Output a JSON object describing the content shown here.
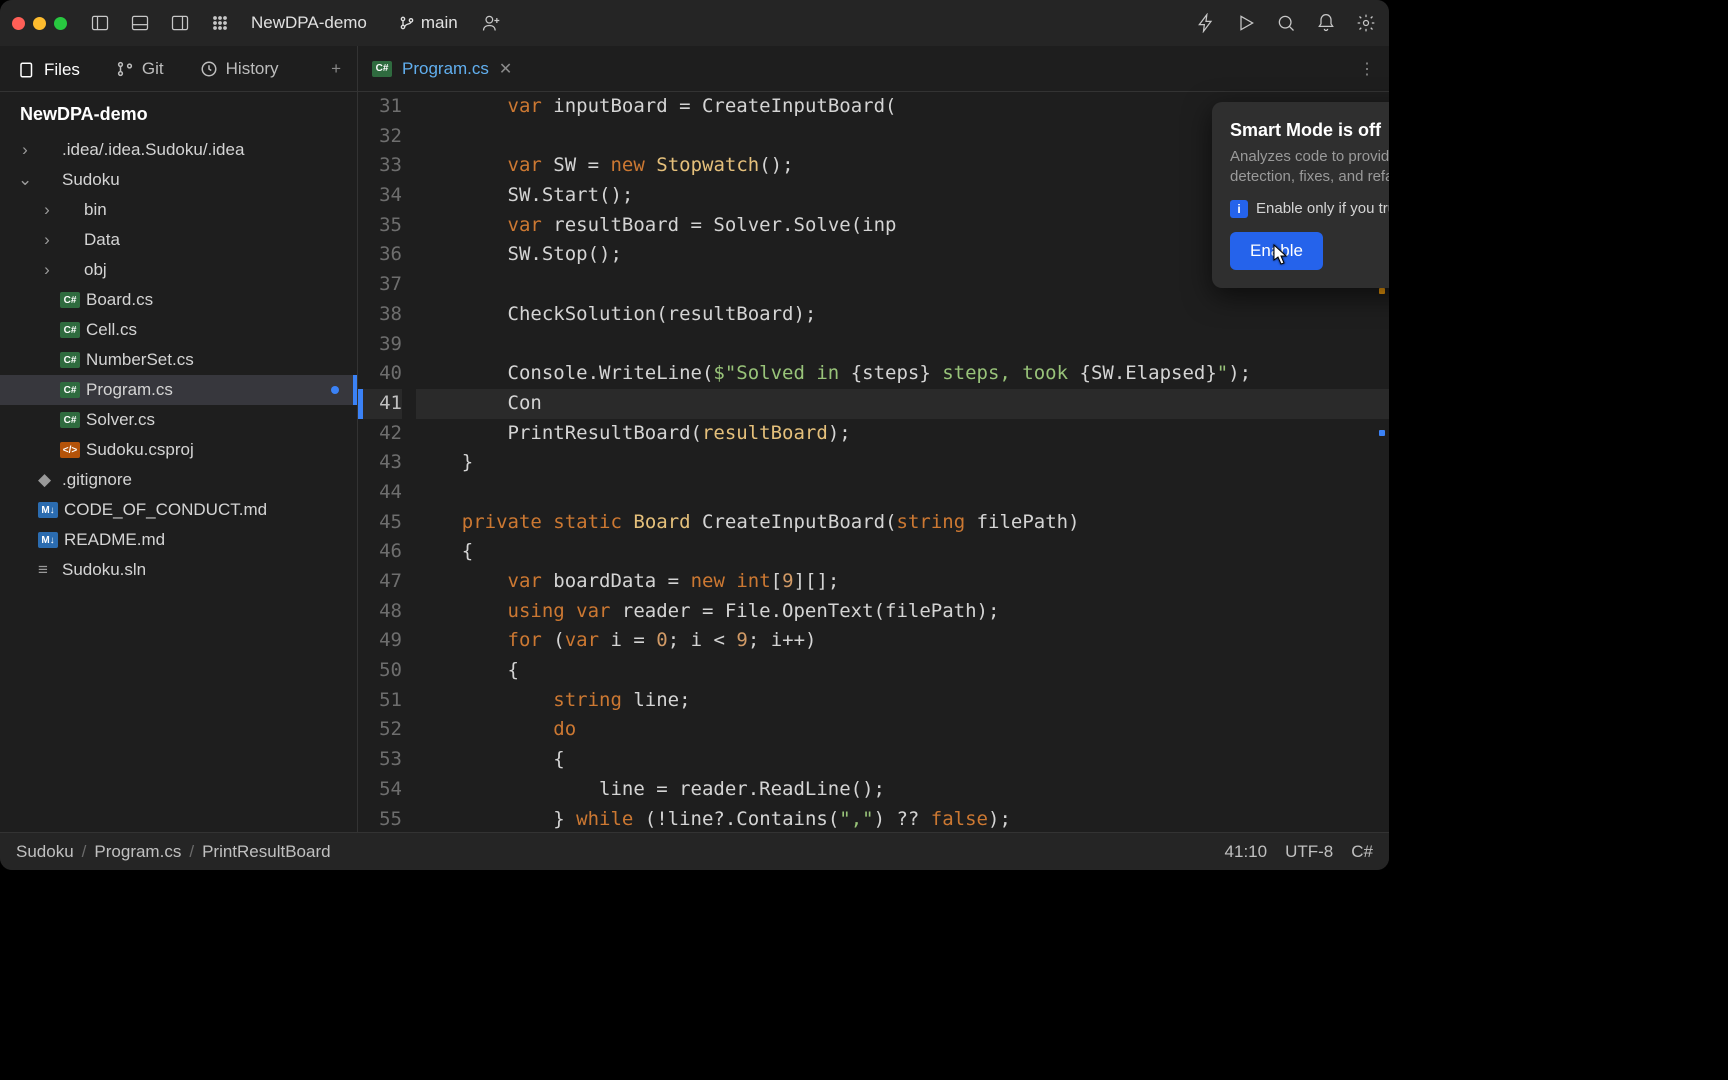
{
  "titlebar": {
    "project": "NewDPA-demo",
    "branch": "main"
  },
  "side_tabs": [
    {
      "icon": "files",
      "label": "Files",
      "active": true
    },
    {
      "icon": "git",
      "label": "Git",
      "active": false
    },
    {
      "icon": "history",
      "label": "History",
      "active": false
    }
  ],
  "project_root": "NewDPA-demo",
  "tree": [
    {
      "depth": 0,
      "chev": "›",
      "icon": "folder",
      "name": ".idea/.idea.Sudoku/.idea"
    },
    {
      "depth": 0,
      "chev": "⌄",
      "icon": "folder",
      "name": "Sudoku"
    },
    {
      "depth": 1,
      "chev": "›",
      "icon": "folder",
      "name": "bin"
    },
    {
      "depth": 1,
      "chev": "›",
      "icon": "folder",
      "name": "Data"
    },
    {
      "depth": 1,
      "chev": "›",
      "icon": "folder",
      "name": "obj"
    },
    {
      "depth": 1,
      "chev": "",
      "icon": "cs",
      "name": "Board.cs"
    },
    {
      "depth": 1,
      "chev": "",
      "icon": "cs",
      "name": "Cell.cs"
    },
    {
      "depth": 1,
      "chev": "",
      "icon": "cs",
      "name": "NumberSet.cs"
    },
    {
      "depth": 1,
      "chev": "",
      "icon": "cs",
      "name": "Program.cs",
      "selected": true,
      "modified": true
    },
    {
      "depth": 1,
      "chev": "",
      "icon": "cs",
      "name": "Solver.cs"
    },
    {
      "depth": 1,
      "chev": "",
      "icon": "xml",
      "name": "Sudoku.csproj"
    },
    {
      "depth": 0,
      "chev": "",
      "icon": "git",
      "name": ".gitignore"
    },
    {
      "depth": 0,
      "chev": "",
      "icon": "md",
      "name": "CODE_OF_CONDUCT.md"
    },
    {
      "depth": 0,
      "chev": "",
      "icon": "md",
      "name": "README.md"
    },
    {
      "depth": 0,
      "chev": "",
      "icon": "sln",
      "name": "Sudoku.sln"
    }
  ],
  "editor_tab": {
    "icon_label": "C#",
    "filename": "Program.cs"
  },
  "code_lines": [
    {
      "n": 31,
      "html": "        <span class='kw'>var</span> inputBoard = CreateInputBoard("
    },
    {
      "n": 32,
      "html": ""
    },
    {
      "n": 33,
      "html": "        <span class='kw'>var</span> SW = <span class='kw'>new</span> <span class='name-gold'>Stopwatch</span>();"
    },
    {
      "n": 34,
      "html": "        SW.Start();"
    },
    {
      "n": 35,
      "html": "        <span class='kw'>var</span> resultBoard = Solver.Solve(inp"
    },
    {
      "n": 36,
      "html": "        SW.Stop();"
    },
    {
      "n": 37,
      "html": ""
    },
    {
      "n": 38,
      "html": "        CheckSolution(resultBoard);"
    },
    {
      "n": 39,
      "html": ""
    },
    {
      "n": 40,
      "html": "        Console.WriteLine(<span class='str'>$\"Solved in </span>{steps}<span class='str'> steps, took </span>{SW.Elapsed}<span class='str'>\"</span>);"
    },
    {
      "n": 41,
      "html": "        Con",
      "active": true
    },
    {
      "n": 42,
      "html": "        PrintResultBoard(<span class='name-gold'>resultBoard</span>);"
    },
    {
      "n": 43,
      "html": "    }"
    },
    {
      "n": 44,
      "html": ""
    },
    {
      "n": 45,
      "html": "    <span class='kw'>private</span> <span class='kw'>static</span> <span class='name-gold'>Board</span> <span class='fn'>CreateInputBoard</span>(<span class='kw'>string</span> filePath)"
    },
    {
      "n": 46,
      "html": "    {"
    },
    {
      "n": 47,
      "html": "        <span class='kw'>var</span> boardData = <span class='kw'>new</span> <span class='kw'>int</span>[<span class='num'>9</span>][];"
    },
    {
      "n": 48,
      "html": "        <span class='kw'>using var</span> reader = File.OpenText(filePath);"
    },
    {
      "n": 49,
      "html": "        <span class='kw'>for</span> (<span class='kw'>var</span> i = <span class='num'>0</span>; i &lt; <span class='num'>9</span>; i++)"
    },
    {
      "n": 50,
      "html": "        {"
    },
    {
      "n": 51,
      "html": "            <span class='kw'>string</span> line;"
    },
    {
      "n": 52,
      "html": "            <span class='kw'>do</span>"
    },
    {
      "n": 53,
      "html": "            {"
    },
    {
      "n": 54,
      "html": "                line = reader.ReadLine();"
    },
    {
      "n": 55,
      "html": "            } <span class='kw'>while</span> (!line?.Contains(<span class='str'>\",\"</span>) ?? <span class='kw'>false</span>);"
    }
  ],
  "popup": {
    "title": "Smart Mode is off",
    "desc": "Analyzes code to provide completion, error detection, fixes, and refactorings",
    "info": "Enable only if you trust the source code",
    "button": "Enable"
  },
  "breadcrumb": {
    "parts": [
      "Sudoku",
      "Program.cs",
      "PrintResultBoard"
    ],
    "pos": "41:10",
    "encoding": "UTF-8",
    "lang": "C#"
  }
}
